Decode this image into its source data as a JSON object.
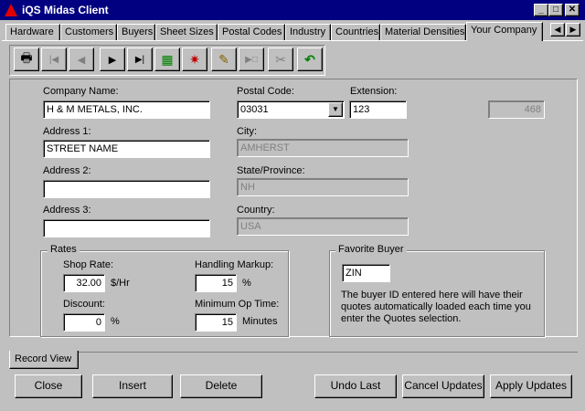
{
  "window": {
    "title": "iQS Midas Client",
    "min_glyph": "_",
    "max_glyph": "□",
    "close_glyph": "✕"
  },
  "tabs": [
    "Hardware",
    "Customers",
    "Buyers",
    "Sheet Sizes",
    "Postal Codes",
    "Industry",
    "Countries",
    "Material Densities",
    "Your Company"
  ],
  "active_tab": "Your Company",
  "tab_scroll": {
    "left": "◀",
    "right": "▶"
  },
  "toolbar": {
    "print": "🖶",
    "first": "|◀",
    "prev": "◀",
    "next": "▶",
    "last": "▶|",
    "export": "▦",
    "tools": "✷",
    "edit": "✎",
    "move": "▶□",
    "cut": "✂",
    "undo": "↶"
  },
  "form": {
    "company_name_label": "Company Name:",
    "company_name": "H & M METALS, INC.",
    "address1_label": "Address 1:",
    "address1": "STREET NAME",
    "address2_label": "Address 2:",
    "address2": "",
    "address3_label": "Address 3:",
    "address3": "",
    "postal_code_label": "Postal Code:",
    "postal_code": "03031",
    "extension_label": "Extension:",
    "extension": "123",
    "record_id": "468",
    "city_label": "City:",
    "city": "AMHERST",
    "state_label": "State/Province:",
    "state": "NH",
    "country_label": "Country:",
    "country": "USA"
  },
  "rates": {
    "legend": "Rates",
    "shop_rate_label": "Shop Rate:",
    "shop_rate": "32.00",
    "shop_rate_unit": "$/Hr",
    "handling_markup_label": "Handling Markup:",
    "handling_markup": "15",
    "handling_unit": "%",
    "discount_label": "Discount:",
    "discount": "0",
    "discount_unit": "%",
    "min_op_time_label": "Minimum Op Time:",
    "min_op_time": "15",
    "min_op_unit": "Minutes"
  },
  "favorite_buyer": {
    "legend": "Favorite Buyer",
    "buyer_id": "ZIN",
    "description": "The buyer ID entered here will have their quotes automatically loaded each time you enter the Quotes selection."
  },
  "bottom_tab": "Record View",
  "buttons": {
    "close": "Close",
    "insert": "Insert",
    "delete": "Delete",
    "undo_last": "Undo Last",
    "cancel_updates": "Cancel Updates",
    "apply_updates": "Apply Updates"
  }
}
